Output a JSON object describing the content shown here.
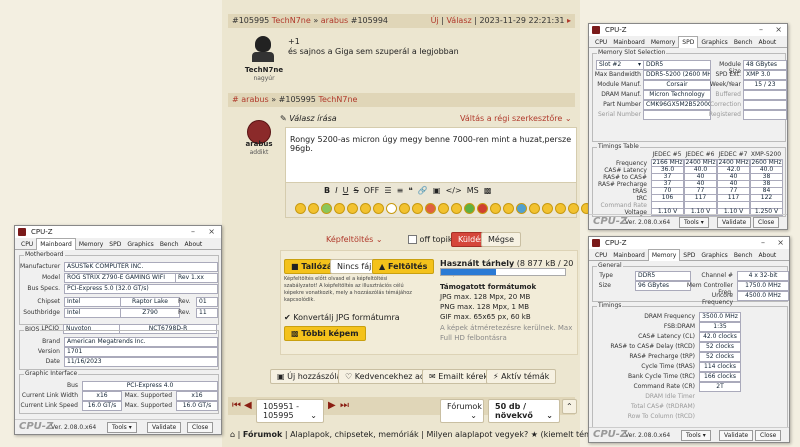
{
  "forum": {
    "post1_header": {
      "num": "#105995",
      "user": "TechN7ne",
      "arrow": "»",
      "reply_user": "arabus",
      "reply_num": "#105994",
      "uj": "Új",
      "valasz": "Válasz",
      "datetime": "2023-11-29 22:21:31"
    },
    "post1": {
      "user": "TechN7ne",
      "role": "nagyúr",
      "line1": "+1",
      "line2": "és sajnos a Giga sem szuperál a legjobban"
    },
    "quote_header": {
      "prefix": "# arabus",
      "arrow": "»",
      "num": "#105995",
      "user": "TechN7ne"
    },
    "reply": {
      "title": "Válasz írása",
      "switch_editor": "Váltás a régi szerkesztőre",
      "user": "arabus",
      "role": "addikt",
      "text": "Rongy 5200-as micron úgy megy benne 7000-ren mint a huzat,persze 96gb."
    },
    "toolbar": {
      "bold": "B",
      "italic": "I",
      "underline": "U",
      "strike": "S",
      "off": "OFF",
      "ms": "MS"
    },
    "images": {
      "label": "Képfeltöltés",
      "off_topic": "off topik",
      "send": "Küldés",
      "cancel": "Mégse"
    },
    "upload": {
      "browse": "Tallózás",
      "no_file": "Nincs fájl",
      "upload": "Feltöltés",
      "storage_title": "Használt tárhely",
      "storage_val": "(8 877 kB / 20 MB)",
      "storage_fraction": 0.44,
      "desc": "Képfeltöltés előtt olvasd el a képfeltöltési szabályzatot! A képfeltöltés az illusztrációs célú képekre vonatkozik, mely a hozzászólás témájához kapcsolódik.",
      "formats_title": "Támogatott formátumok",
      "jpg": "JPG max. 128 Mpx, 20 MB",
      "png": "PNG max. 128 Mpx, 1 MB",
      "gif": "GIF max. 65x65 px, 60 kB",
      "note": "A képek átméretezésre kerülnek. Max Full HD felbontásra",
      "convert": "Konvertálj JPG formátumra",
      "more": "Többi képem"
    },
    "actions": {
      "new": "Új hozzászólás",
      "fav": "Kedvencekhez adom",
      "email": "Emailt kérek",
      "active": "Aktív témák"
    },
    "pager": {
      "range": "105951 - 105995",
      "forum": "Fórumok",
      "per_page": "50 db / növekvő"
    },
    "breadcrumb": {
      "home": "Fórumok",
      "b1": "Alaplapok, chipsetek, memóriák",
      "b2": "Milyen alaplapot vegyek?",
      "b3": "(kiemelt téma)"
    }
  },
  "cpuz_left": {
    "title": "CPU-Z",
    "tabs": [
      "CPU",
      "Mainboard",
      "Memory",
      "SPD",
      "Graphics",
      "Bench",
      "About"
    ],
    "active": "Mainboard",
    "mb_group": "Motherboard",
    "manufacturer_l": "Manufacturer",
    "manufacturer": "ASUSTeK COMPUTER INC.",
    "model_l": "Model",
    "model": "ROG STRIX Z790-E GAMING WIFI",
    "model_rev": "Rev 1.xx",
    "busspecs_l": "Bus Specs.",
    "busspecs": "PCI-Express 5.0 (32.0 GT/s)",
    "chipset_l": "Chipset",
    "chipset": "Intel",
    "chipset2": "Raptor Lake",
    "rev_l": "Rev.",
    "chipset_rev": "01",
    "south_l": "Southbridge",
    "south": "Intel",
    "south2": "Z790",
    "south_rev": "11",
    "lpcio_l": "LPCIO",
    "lpcio": "Nuvoton",
    "lpcio2": "NCT6798D-R",
    "bios_group": "BIOS",
    "brand_l": "Brand",
    "brand": "American Megatrends Inc.",
    "version_l": "Version",
    "version": "1701",
    "date_l": "Date",
    "date": "11/16/2023",
    "gi_group": "Graphic Interface",
    "bus_l": "Bus",
    "bus": "PCI-Express 4.0",
    "clw_l": "Current Link Width",
    "clw": "x16",
    "ms_l": "Max. Supported",
    "msw": "x16",
    "cls_l": "Current Link Speed",
    "cls": "16.0 GT/s",
    "mss": "16.0 GT/s",
    "version_text": "Ver. 2.08.0.x64",
    "tools": "Tools",
    "validate": "Validate",
    "close": "Close",
    "logo": "CPU-Z"
  },
  "cpuz_spd": {
    "title": "CPU-Z",
    "tabs": [
      "CPU",
      "Mainboard",
      "Memory",
      "SPD",
      "Graphics",
      "Bench",
      "About"
    ],
    "active": "SPD",
    "slot_group": "Memory Slot Selection",
    "slot": "Slot #2",
    "type": "DDR5",
    "modsize_l": "Module Size",
    "modsize": "48 GBytes",
    "maxbw_l": "Max Bandwidth",
    "maxbw": "DDR5-5200 (2600 MHz)",
    "spdext_l": "SPD Ext.",
    "spdext": "XMP 3.0",
    "modmanuf_l": "Module Manuf.",
    "modmanuf": "Corsair",
    "week_l": "Week/Year",
    "week": "15 / 23",
    "drammanuf_l": "DRAM Manuf.",
    "drammanuf": "Micron Technology",
    "buffered_l": "Buffered",
    "part_l": "Part Number",
    "part": "CMK96GX5M2B5200C38",
    "correction_l": "Correction",
    "serial_l": "Serial Number",
    "registered_l": "Registered",
    "timings_group": "Timings Table",
    "cols": [
      "JEDEC #5",
      "JEDEC #6",
      "JEDEC #7",
      "XMP-5200"
    ],
    "rows": [
      {
        "l": "Frequency",
        "v": [
          "2166 MHz",
          "2400 MHz",
          "2400 MHz",
          "2600 MHz"
        ]
      },
      {
        "l": "CAS# Latency",
        "v": [
          "36.0",
          "40.0",
          "42.0",
          "40.0"
        ]
      },
      {
        "l": "RAS# to CAS#",
        "v": [
          "37",
          "40",
          "40",
          "38"
        ]
      },
      {
        "l": "RAS# Precharge",
        "v": [
          "37",
          "40",
          "40",
          "38"
        ]
      },
      {
        "l": "tRAS",
        "v": [
          "70",
          "77",
          "77",
          "84"
        ]
      },
      {
        "l": "tRC",
        "v": [
          "106",
          "117",
          "117",
          "122"
        ]
      },
      {
        "l": "Command Rate",
        "v": [
          "",
          "",
          "",
          ""
        ]
      },
      {
        "l": "Voltage",
        "v": [
          "1.10 V",
          "1.10 V",
          "1.10 V",
          "1.250 V"
        ]
      }
    ],
    "version_text": "Ver. 2.08.0.x64",
    "tools": "Tools",
    "validate": "Validate",
    "close": "Close",
    "logo": "CPU-Z"
  },
  "cpuz_mem": {
    "title": "CPU-Z",
    "tabs": [
      "CPU",
      "Mainboard",
      "Memory",
      "SPD",
      "Graphics",
      "Bench",
      "About"
    ],
    "active": "Memory",
    "gen_group": "General",
    "type_l": "Type",
    "type": "DDR5",
    "channel_l": "Channel #",
    "channel": "4 x 32-bit",
    "size_l": "Size",
    "size": "96 GBytes",
    "memctrl_l": "Mem Controller Freq.",
    "memctrl": "1750.0 MHz",
    "uncore_l": "Uncore Frequency",
    "uncore": "4500.0 MHz",
    "tim_group": "Timings",
    "rows": [
      {
        "l": "DRAM Frequency",
        "v": "3500.0 MHz"
      },
      {
        "l": "FSB:DRAM",
        "v": "1:35"
      },
      {
        "l": "CAS# Latency (CL)",
        "v": "42.0 clocks"
      },
      {
        "l": "RAS# to CAS# Delay (tRCD)",
        "v": "52 clocks"
      },
      {
        "l": "RAS# Precharge (tRP)",
        "v": "52 clocks"
      },
      {
        "l": "Cycle Time (tRAS)",
        "v": "114 clocks"
      },
      {
        "l": "Bank Cycle Time (tRC)",
        "v": "166 clocks"
      },
      {
        "l": "Command Rate (CR)",
        "v": "2T"
      },
      {
        "l": "DRAM Idle Timer",
        "v": ""
      },
      {
        "l": "Total CAS# (tRDRAM)",
        "v": ""
      },
      {
        "l": "Row To Column (tRCD)",
        "v": ""
      }
    ],
    "version_text": "Ver. 2.08.0.x64",
    "tools": "Tools",
    "validate": "Validate",
    "close": "Close",
    "logo": "CPU-Z"
  }
}
